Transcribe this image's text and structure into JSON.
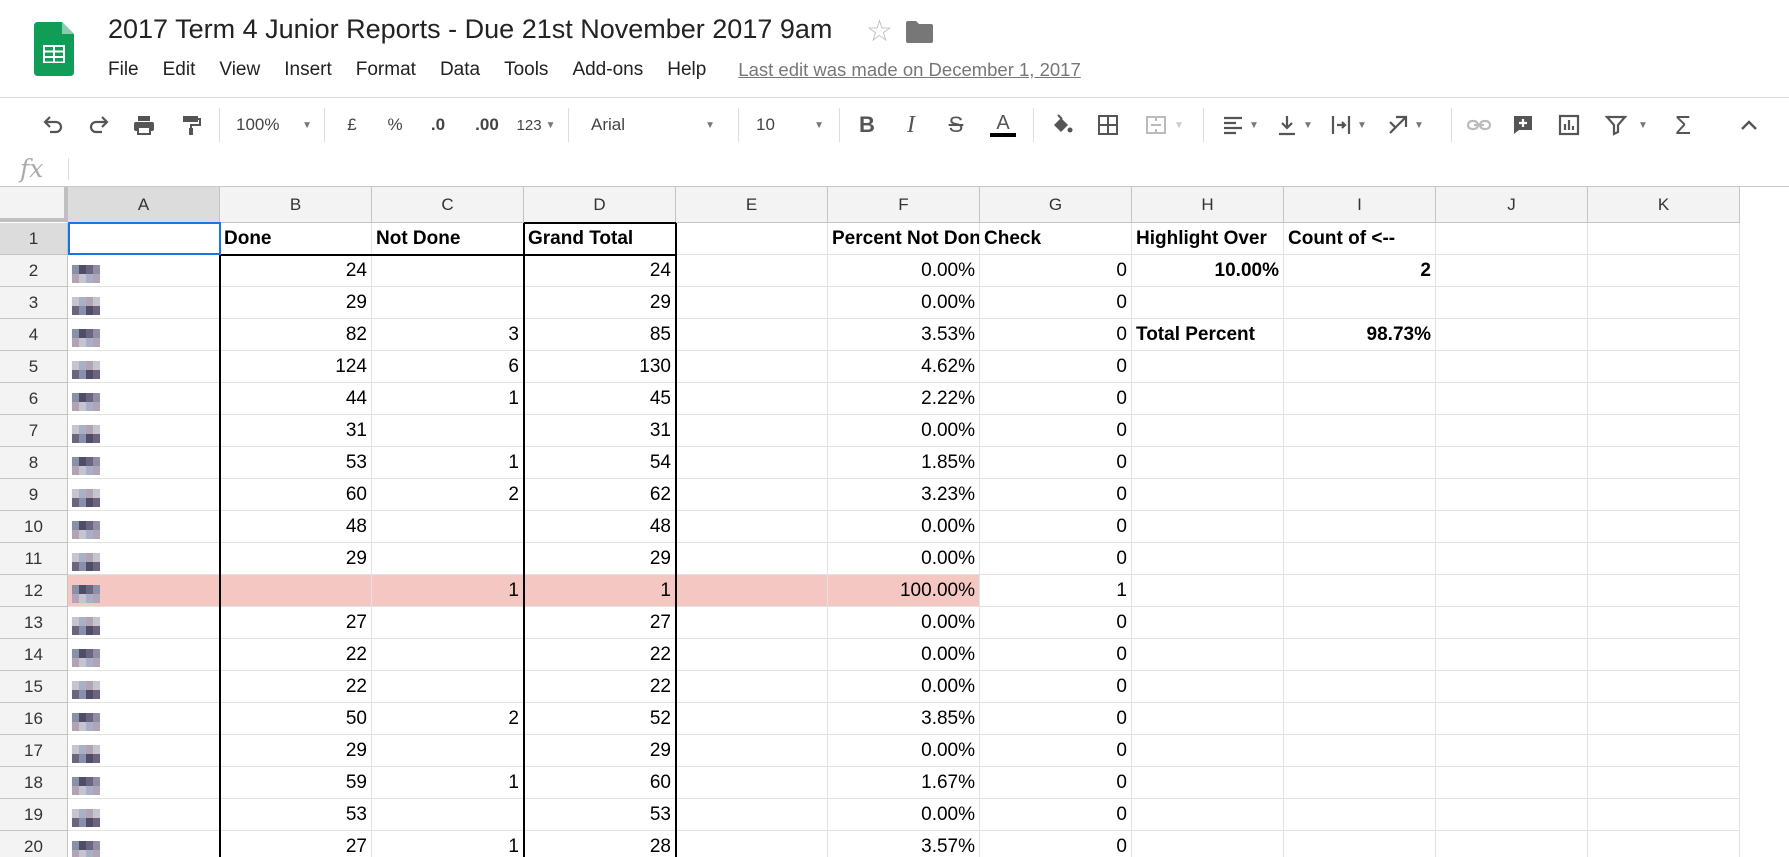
{
  "app": {
    "doc_title": "2017 Term 4 Junior Reports - Due 21st November 2017 9am",
    "last_edit": "Last edit was made on December 1, 2017",
    "menu": [
      "File",
      "Edit",
      "View",
      "Insert",
      "Format",
      "Data",
      "Tools",
      "Add-ons",
      "Help"
    ]
  },
  "toolbar": {
    "zoom": "100%",
    "currency": "£",
    "percent": "%",
    "decimal_decrease": ".0",
    "decimal_increase": ".00",
    "more_formats": "123",
    "font": "Arial",
    "font_size": "10"
  },
  "formula_bar": {
    "fx": "fx",
    "value": ""
  },
  "columns": [
    "A",
    "B",
    "C",
    "D",
    "E",
    "F",
    "G",
    "H",
    "I",
    "J",
    "K"
  ],
  "row_numbers": [
    "1",
    "2",
    "3",
    "4",
    "5",
    "6",
    "7",
    "8",
    "9",
    "10",
    "11",
    "12",
    "13",
    "14",
    "15",
    "16",
    "17",
    "18",
    "19",
    "20"
  ],
  "headers": {
    "done": "Done",
    "not_done": "Not Done",
    "grand_total": "Grand Total",
    "percent_not_done": "Percent Not Done",
    "check": "Check",
    "highlight_over": "Highlight Over",
    "count_of": "Count of <--",
    "highlight_value": "10.00%",
    "count_value": "2",
    "total_percent_label": "Total Percent",
    "total_percent_value": "98.73%"
  },
  "rows": [
    {
      "done": "24",
      "not_done": "",
      "total": "24",
      "pct": "0.00%",
      "check": "0"
    },
    {
      "done": "29",
      "not_done": "",
      "total": "29",
      "pct": "0.00%",
      "check": "0"
    },
    {
      "done": "82",
      "not_done": "3",
      "total": "85",
      "pct": "3.53%",
      "check": "0"
    },
    {
      "done": "124",
      "not_done": "6",
      "total": "130",
      "pct": "4.62%",
      "check": "0"
    },
    {
      "done": "44",
      "not_done": "1",
      "total": "45",
      "pct": "2.22%",
      "check": "0"
    },
    {
      "done": "31",
      "not_done": "",
      "total": "31",
      "pct": "0.00%",
      "check": "0"
    },
    {
      "done": "53",
      "not_done": "1",
      "total": "54",
      "pct": "1.85%",
      "check": "0"
    },
    {
      "done": "60",
      "not_done": "2",
      "total": "62",
      "pct": "3.23%",
      "check": "0"
    },
    {
      "done": "48",
      "not_done": "",
      "total": "48",
      "pct": "0.00%",
      "check": "0"
    },
    {
      "done": "29",
      "not_done": "",
      "total": "29",
      "pct": "0.00%",
      "check": "0"
    },
    {
      "done": "",
      "not_done": "1",
      "total": "1",
      "pct": "100.00%",
      "check": "1",
      "highlight": true
    },
    {
      "done": "27",
      "not_done": "",
      "total": "27",
      "pct": "0.00%",
      "check": "0"
    },
    {
      "done": "22",
      "not_done": "",
      "total": "22",
      "pct": "0.00%",
      "check": "0"
    },
    {
      "done": "22",
      "not_done": "",
      "total": "22",
      "pct": "0.00%",
      "check": "0"
    },
    {
      "done": "50",
      "not_done": "2",
      "total": "52",
      "pct": "3.85%",
      "check": "0"
    },
    {
      "done": "29",
      "not_done": "",
      "total": "29",
      "pct": "0.00%",
      "check": "0"
    },
    {
      "done": "59",
      "not_done": "1",
      "total": "60",
      "pct": "1.67%",
      "check": "0"
    },
    {
      "done": "53",
      "not_done": "",
      "total": "53",
      "pct": "0.00%",
      "check": "0"
    },
    {
      "done": "27",
      "not_done": "1",
      "total": "28",
      "pct": "3.57%",
      "check": "0"
    }
  ],
  "colors": {
    "highlight": "#f4c7c3",
    "selection": "#1a73e8",
    "sheets_green": "#0f9d58"
  }
}
